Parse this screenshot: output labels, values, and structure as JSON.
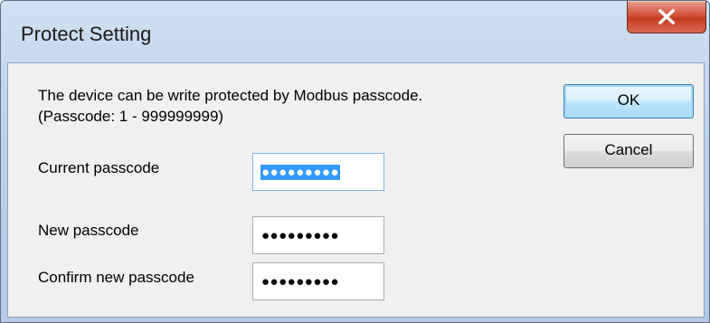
{
  "window": {
    "title": "Protect Setting"
  },
  "description": {
    "line1": "The device can be write protected by Modbus passcode.",
    "line2": "(Passcode: 1 - 999999999)"
  },
  "fields": {
    "current": {
      "label": "Current passcode",
      "mask": "●●●●●●●●●",
      "selected": true
    },
    "new": {
      "label": "New passcode",
      "mask": "●●●●●●●●●"
    },
    "confirm": {
      "label": "Confirm new passcode",
      "mask": "●●●●●●●●●"
    }
  },
  "buttons": {
    "ok": "OK",
    "cancel": "Cancel"
  },
  "icons": {
    "close": "close-icon"
  },
  "colors": {
    "selection": "#3399ff",
    "close_button": "#c33a22"
  }
}
